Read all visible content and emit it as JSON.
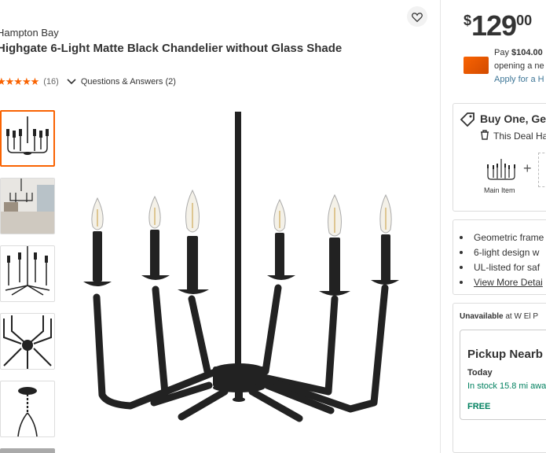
{
  "product": {
    "brand": "Hampton Bay",
    "title": "Highgate 6-Light Matte Black Chandelier without Glass Shade",
    "stars": "★★★★★",
    "review_count": "(16)",
    "qa_label": "Questions & Answers (2)",
    "rating_value": 5
  },
  "icons": {
    "favorite": "heart-icon",
    "chevron": "chevron-down-icon",
    "tag": "tag-icon",
    "trash": "trash-icon"
  },
  "pricing": {
    "currency": "$",
    "dollars": "129",
    "cents": "00",
    "pay_prefix": "Pay ",
    "pay_amount": "$104.00",
    "pay_line2": "opening a ne",
    "apply_link": "Apply for a H"
  },
  "promo": {
    "title": "Buy One, Ge",
    "deal": "This Deal Ha",
    "plus": "+",
    "main_item_label": "Main Item"
  },
  "highlights": [
    {
      "text": "Geometric frame"
    },
    {
      "text": "6-light design w"
    },
    {
      "text": "UL-listed for saf"
    },
    {
      "text": "View More Detai"
    }
  ],
  "fulfillment": {
    "unavailable_label": "Unavailable",
    "unavailable_rest": " at W El P",
    "pickup_title": "Pickup Nearb",
    "today": "Today",
    "stock": "In stock 15.8 mi awa",
    "free": "FREE"
  },
  "colors": {
    "accent": "#f96302",
    "link": "#3e7697",
    "in_stock": "#00805f"
  }
}
